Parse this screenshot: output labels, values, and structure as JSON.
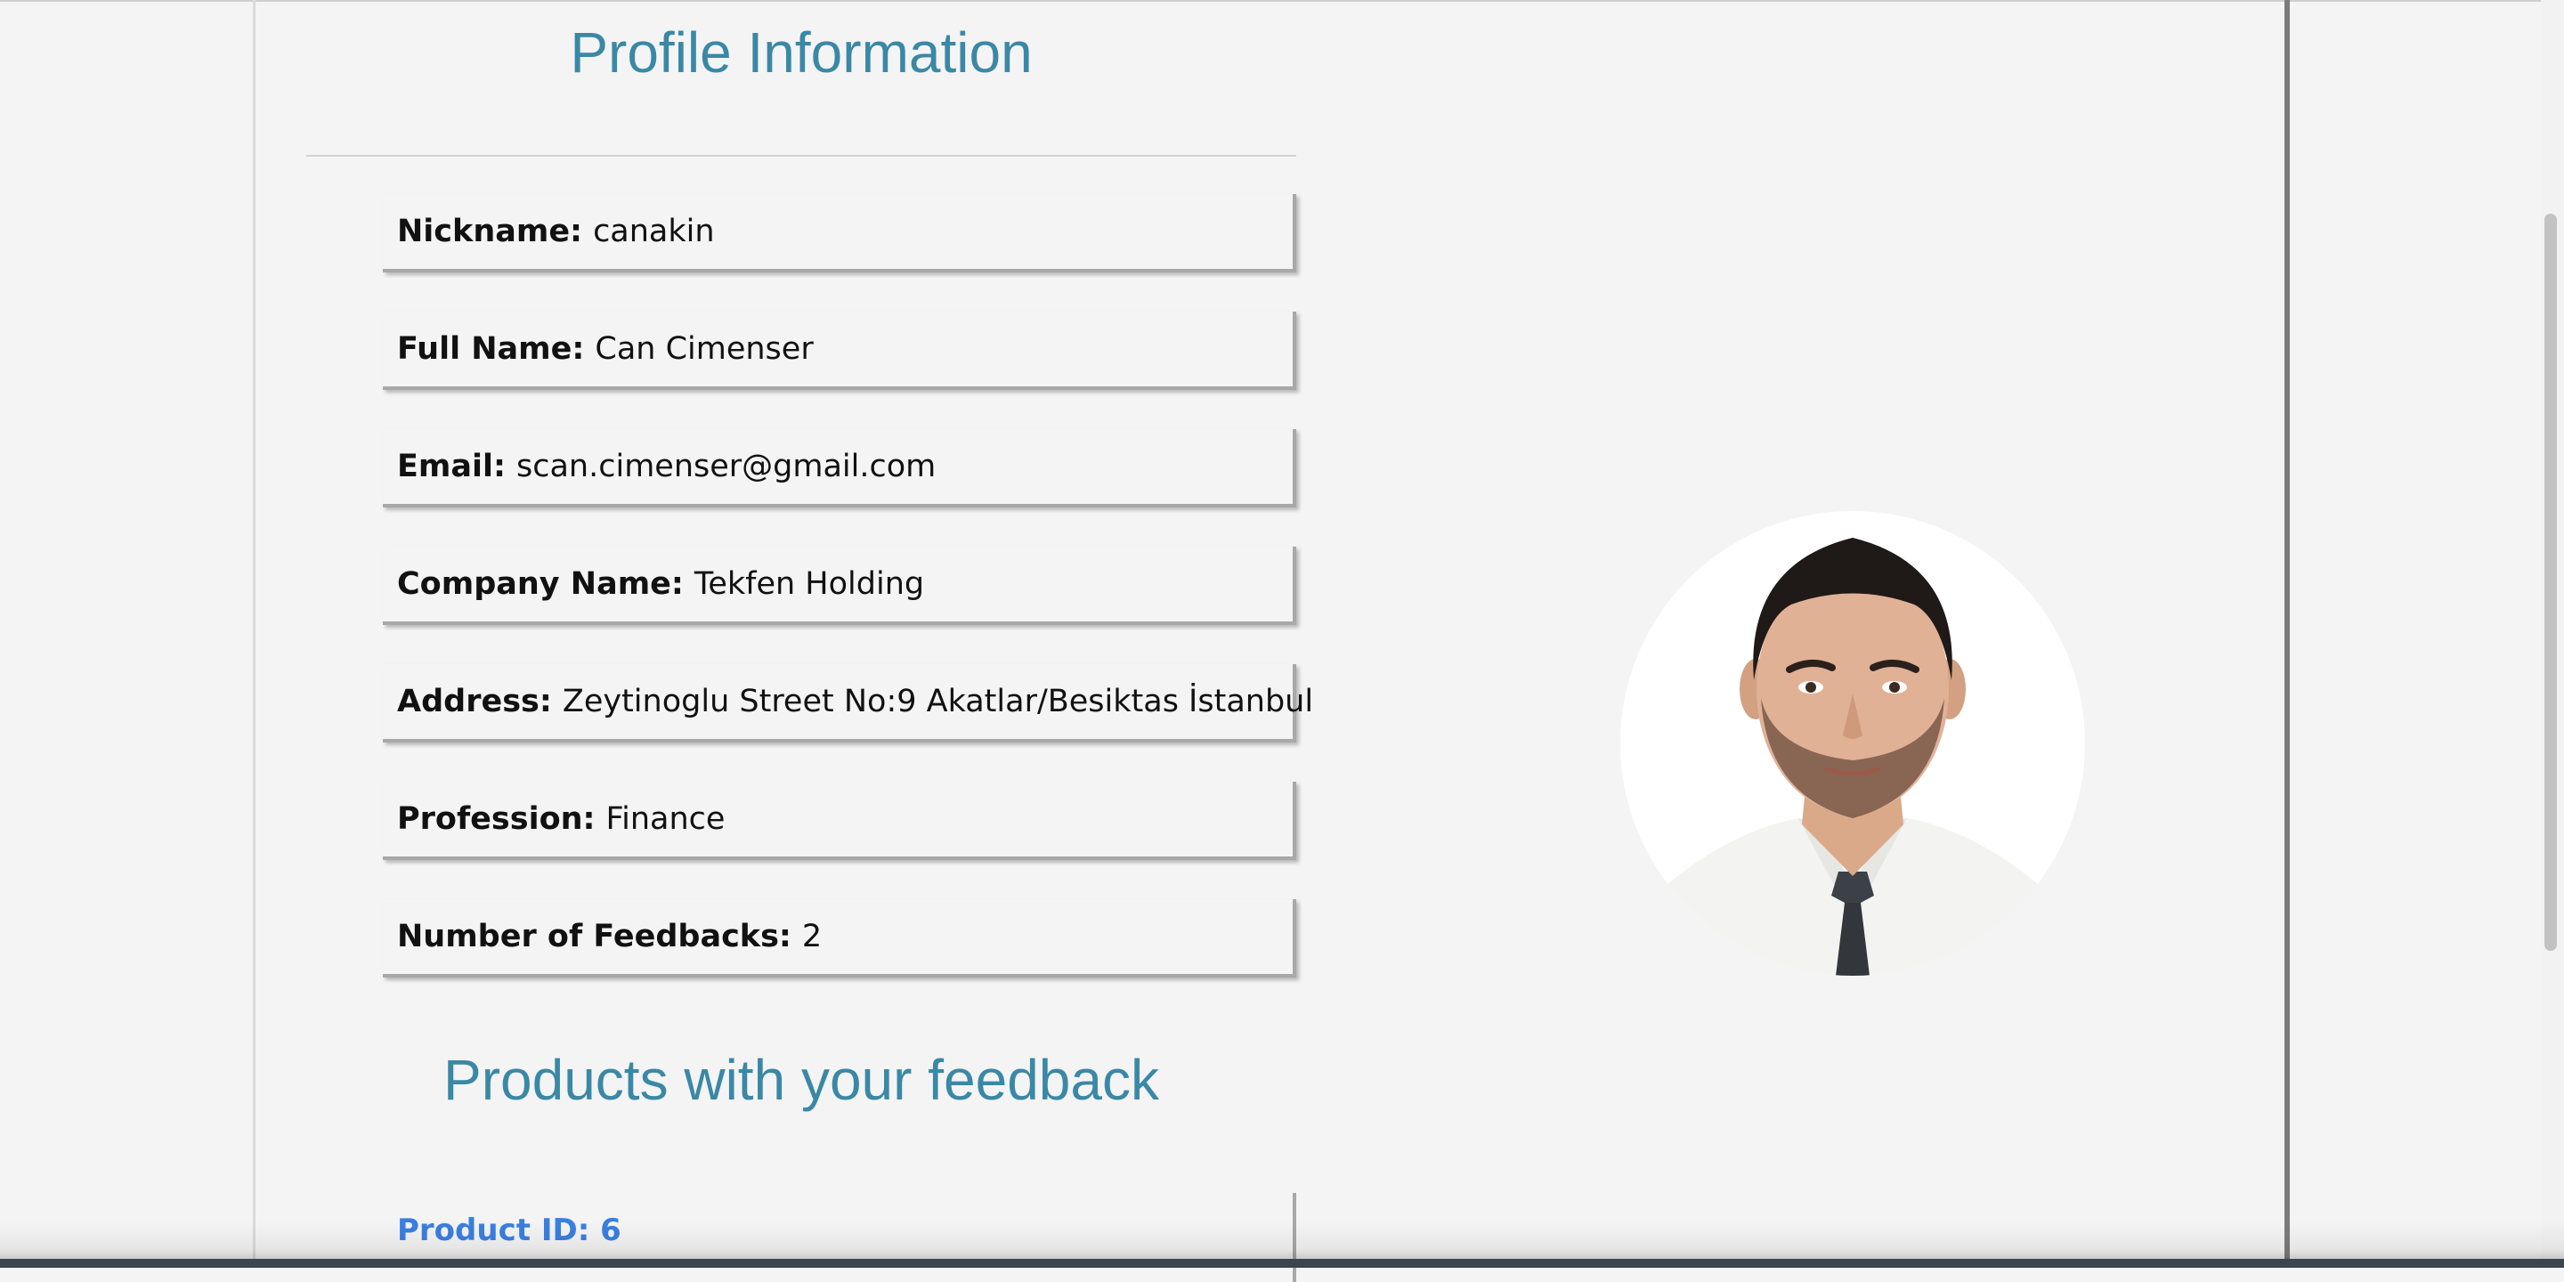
{
  "profile": {
    "title": "Profile Information",
    "fields": [
      {
        "label": "Nickname:",
        "value": "canakin"
      },
      {
        "label": "Full Name:",
        "value": "Can Cimenser"
      },
      {
        "label": "Email:",
        "value": "scan.cimenser@gmail.com"
      },
      {
        "label": "Company Name:",
        "value": "Tekfen Holding"
      },
      {
        "label": "Address:",
        "value": "Zeytinoglu Street No:9 Akatlar/Besiktas İstanbul"
      },
      {
        "label": "Profession:",
        "value": "Finance"
      },
      {
        "label": "Number of Feedbacks:",
        "value": "2"
      }
    ]
  },
  "feedback": {
    "title": "Products with your feedback",
    "products": [
      {
        "label": "Product ID: 6"
      }
    ]
  },
  "colors": {
    "heading": "#3a88a6",
    "product_link": "#3a7fe0",
    "background": "#f4f4f4"
  },
  "icons": {
    "avatar": "profile-photo"
  }
}
